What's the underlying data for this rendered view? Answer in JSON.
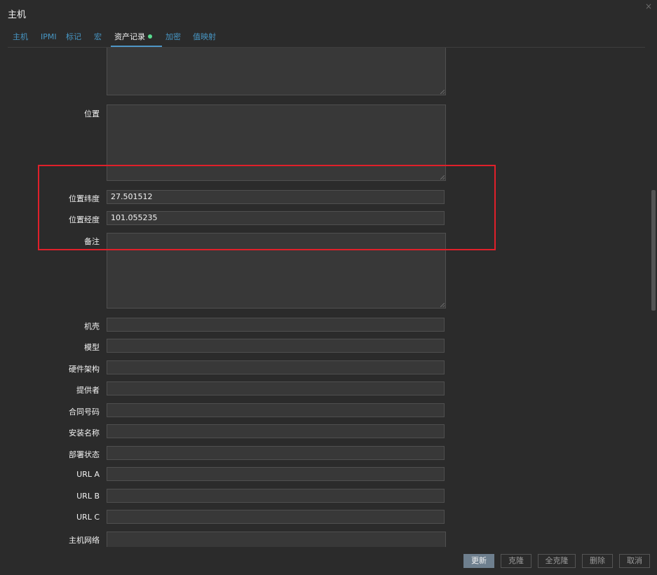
{
  "dialog": {
    "title": "主机",
    "close_glyph": "×"
  },
  "tabs": [
    {
      "label": "主机"
    },
    {
      "label": "IPMI"
    },
    {
      "label": "标记"
    },
    {
      "label": "宏"
    },
    {
      "label": "资产记录",
      "active": true
    },
    {
      "label": "加密"
    },
    {
      "label": "值映射"
    }
  ],
  "fields": {
    "location": {
      "label": "位置"
    },
    "location_lat": {
      "label": "位置纬度",
      "value": "27.501512"
    },
    "location_lon": {
      "label": "位置经度",
      "value": "101.055235"
    },
    "notes": {
      "label": "备注"
    },
    "chassis": {
      "label": "机壳",
      "value": ""
    },
    "model": {
      "label": "模型",
      "value": ""
    },
    "hw_arch": {
      "label": "硬件架构",
      "value": ""
    },
    "vendor": {
      "label": "提供者",
      "value": ""
    },
    "contract_number": {
      "label": "合同号码",
      "value": ""
    },
    "installer_name": {
      "label": "安装名称",
      "value": ""
    },
    "deployment_status": {
      "label": "部署状态",
      "value": ""
    },
    "url_a": {
      "label": "URL A",
      "value": ""
    },
    "url_b": {
      "label": "URL B",
      "value": ""
    },
    "url_c": {
      "label": "URL C",
      "value": ""
    },
    "host_networks": {
      "label": "主机网络",
      "value": ""
    }
  },
  "buttons": {
    "update": "更新",
    "clone": "克隆",
    "full_clone": "全克隆",
    "delete": "删除",
    "cancel": "取消"
  },
  "colors": {
    "background": "#2b2b2b",
    "link": "#4796c4",
    "active_dot": "#59db8f",
    "highlight": "#e0202a",
    "primary_button": "#6e7f8e"
  }
}
